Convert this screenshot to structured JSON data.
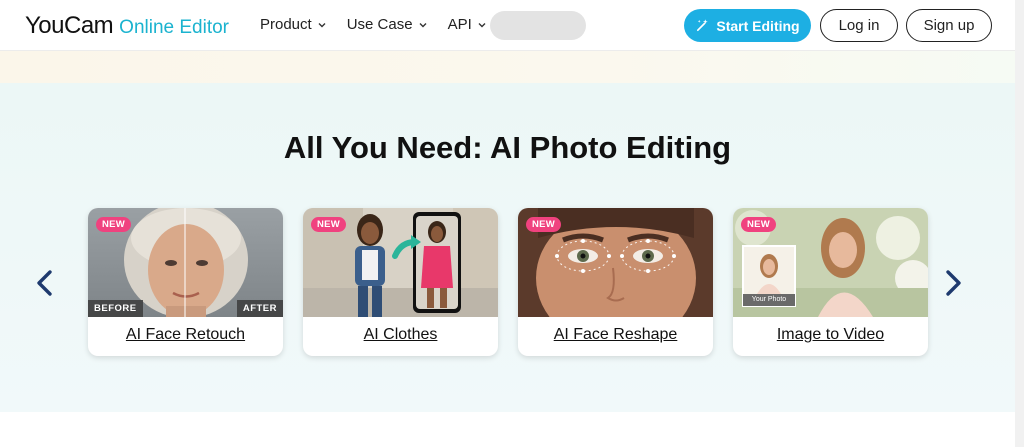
{
  "header": {
    "logo_main": "YouCam",
    "logo_sub": "Online Editor",
    "nav": [
      {
        "label": "Product"
      },
      {
        "label": "Use Case"
      },
      {
        "label": "API"
      }
    ],
    "start_editing": "Start Editing",
    "login": "Log in",
    "signup": "Sign up"
  },
  "section": {
    "title": "All You Need: AI Photo Editing",
    "cards": [
      {
        "label": "AI Face Retouch",
        "badge": "NEW",
        "before": "BEFORE",
        "after": "AFTER"
      },
      {
        "label": "AI Clothes",
        "badge": "NEW"
      },
      {
        "label": "AI Face Reshape",
        "badge": "NEW"
      },
      {
        "label": "Image to Video",
        "badge": "NEW",
        "inset_caption": "Your Photo"
      }
    ]
  },
  "colors": {
    "accent": "#1dafe3",
    "logo_accent": "#1bb3cf",
    "badge": "#f0427f",
    "arrow": "#1e3a6e"
  }
}
